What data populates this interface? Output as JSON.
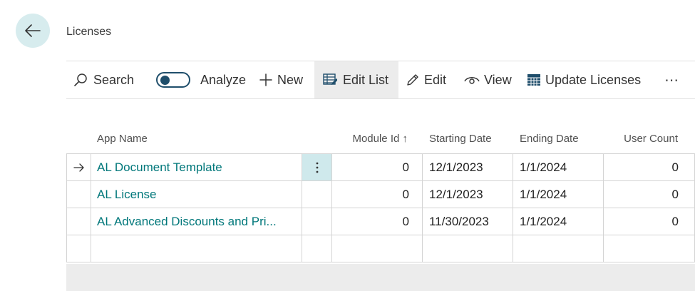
{
  "page": {
    "title": "Licenses"
  },
  "toolbar": {
    "search": "Search",
    "analyze": "Analyze",
    "new": "New",
    "edit_list": "Edit List",
    "edit": "Edit",
    "view": "View",
    "update_licenses": "Update Licenses",
    "more": "⋯"
  },
  "columns": {
    "app_name": "App Name",
    "module_id": "Module Id ↑",
    "starting_date": "Starting Date",
    "ending_date": "Ending Date",
    "user_count": "User Count"
  },
  "rows": [
    {
      "app_name": "AL Document Template",
      "module_id": "0",
      "starting_date": "12/1/2023",
      "ending_date": "1/1/2024",
      "user_count": "0"
    },
    {
      "app_name": "AL License",
      "module_id": "0",
      "starting_date": "12/1/2023",
      "ending_date": "1/1/2024",
      "user_count": "0"
    },
    {
      "app_name": "AL Advanced Discounts and Pri...",
      "module_id": "0",
      "starting_date": "11/30/2023",
      "ending_date": "1/1/2024",
      "user_count": "0"
    }
  ],
  "colors": {
    "accent": "#00777a",
    "back_bg": "#d7ecee",
    "toggle": "#1f4e6b"
  }
}
